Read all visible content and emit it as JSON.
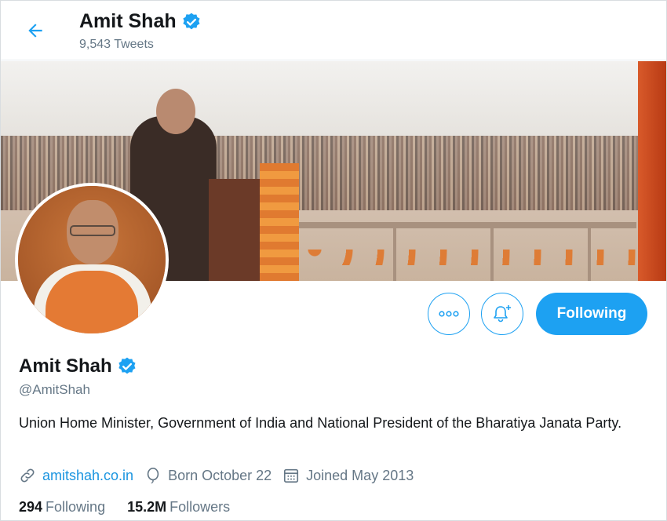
{
  "header": {
    "name": "Amit Shah",
    "tweet_count": "9,543 Tweets"
  },
  "profile": {
    "name": "Amit Shah",
    "handle": "@AmitShah",
    "bio": "Union Home Minister, Government of India and National President of the Bharatiya Janata Party.",
    "website": "amitshah.co.in",
    "birthday": "Born October 22",
    "joined": "Joined May 2013",
    "following_count": "294",
    "following_label": "Following",
    "followers_count": "15.2M",
    "followers_label": "Followers"
  },
  "actions": {
    "follow_label": "Following"
  },
  "icons": {
    "back": "back-arrow-icon",
    "verified": "verified-badge-icon",
    "more": "more-icon",
    "notify": "notification-bell-icon",
    "link": "link-icon",
    "birthday": "balloon-icon",
    "calendar": "calendar-icon"
  },
  "colors": {
    "accent": "#1da1f2",
    "link": "#1b95e0",
    "muted": "#657786",
    "text": "#14171a"
  }
}
